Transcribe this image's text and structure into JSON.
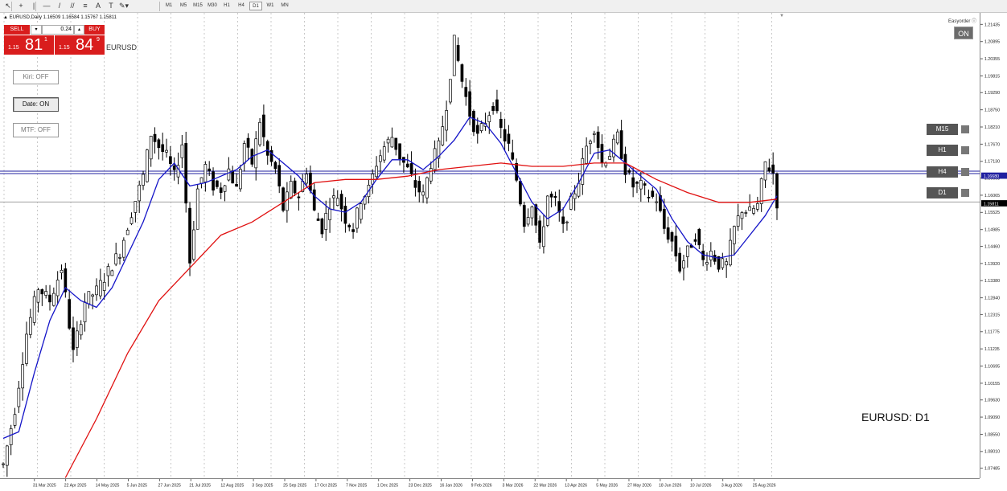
{
  "toolbar": {
    "icons": [
      {
        "name": "cursor-icon",
        "glyph": "↖"
      },
      {
        "name": "crosshair-icon",
        "glyph": "+"
      },
      {
        "name": "vertical-line-icon",
        "glyph": "|"
      },
      {
        "name": "horizontal-line-icon",
        "glyph": "—"
      },
      {
        "name": "trendline-icon",
        "glyph": "/"
      },
      {
        "name": "equidistant-channel-icon",
        "glyph": "//"
      },
      {
        "name": "fibonacci-icon",
        "glyph": "≡"
      },
      {
        "name": "text-icon",
        "glyph": "A"
      },
      {
        "name": "text-label-icon",
        "glyph": "T"
      },
      {
        "name": "shapes-menu-icon",
        "glyph": "✎▾"
      }
    ],
    "timeframes": [
      "M1",
      "M5",
      "M15",
      "M30",
      "H1",
      "H4",
      "D1",
      "W1",
      "MN"
    ],
    "active_timeframe": "D1"
  },
  "header": {
    "text": "▲ EURUSD,Daily  1.16509 1.16584 1.15767 1.15811"
  },
  "trade_panel": {
    "sell_label": "SELL",
    "buy_label": "BUY",
    "volume": "0.24",
    "down_arrow": "▾",
    "up_arrow": "▴",
    "bid_prefix": "1.15",
    "bid_big": "81",
    "bid_sup": "1",
    "ask_prefix": "1.15",
    "ask_big": "84",
    "ask_sup": "9",
    "symbol": "EURUSD",
    "color": "#d91d1d"
  },
  "toggles": [
    {
      "name": "kiri-toggle-button",
      "label": "Kiri: OFF",
      "on": false
    },
    {
      "name": "date-toggle-button",
      "label": "Date: ON",
      "on": true
    },
    {
      "name": "mtf-toggle-button",
      "label": "MTF: OFF",
      "on": false
    }
  ],
  "easyorder": {
    "label": "Easyorder ⓘ",
    "state": "ON"
  },
  "mtf_buttons": [
    "M15",
    "H1",
    "H4",
    "D1"
  ],
  "watermark": "EURUSD: D1",
  "chart_data": {
    "type": "candlestick",
    "symbol": "EURUSD",
    "timeframe": "D1",
    "x_ticks": [
      "31 Mar 2025",
      "22 Apr 2025",
      "14 May 2025",
      "5 Jun 2025",
      "27 Jun 2025",
      "21 Jul 2025",
      "12 Aug 2025",
      "3 Sep 2025",
      "25 Sep 2025",
      "17 Oct 2025",
      "7 Nov 2025",
      "1 Dec 2025",
      "23 Dec 2025",
      "16 Jan 2026",
      "9 Feb 2026",
      "3 Mar 2026",
      "22 Mar 2026",
      "13 Apr 2026",
      "5 May 2026",
      "27 May 2026",
      "18 Jun 2026",
      "10 Jul 2026",
      "3 Aug 2026",
      "25 Aug 2026"
    ],
    "y_ticks": [
      "1.21435",
      "1.20895",
      "1.20355",
      "1.19815",
      "1.19290",
      "1.18750",
      "1.18210",
      "1.17670",
      "1.17130",
      "1.16605",
      "1.16065",
      "1.15525",
      "1.14985",
      "1.14460",
      "1.13920",
      "1.13380",
      "1.12840",
      "1.12315",
      "1.11775",
      "1.11235",
      "1.10695",
      "1.10155",
      "1.09630",
      "1.09090",
      "1.08550",
      "1.08010",
      "1.07485"
    ],
    "ylim": [
      1.07485,
      1.21435
    ],
    "current_bid": "1.15811",
    "horizontal_line": "1.16680",
    "price_path": [
      [
        0,
        1.078
      ],
      [
        3,
        1.095
      ],
      [
        6,
        1.118
      ],
      [
        9,
        1.132
      ],
      [
        12,
        1.128
      ],
      [
        15,
        1.138
      ],
      [
        18,
        1.112
      ],
      [
        21,
        1.128
      ],
      [
        24,
        1.131
      ],
      [
        27,
        1.137
      ],
      [
        30,
        1.143
      ],
      [
        33,
        1.155
      ],
      [
        36,
        1.166
      ],
      [
        38,
        1.179
      ],
      [
        40,
        1.175
      ],
      [
        42,
        1.172
      ],
      [
        44,
        1.166
      ],
      [
        46,
        1.176
      ],
      [
        48,
        1.14
      ],
      [
        50,
        1.162
      ],
      [
        52,
        1.169
      ],
      [
        54,
        1.163
      ],
      [
        56,
        1.162
      ],
      [
        58,
        1.168
      ],
      [
        60,
        1.162
      ],
      [
        62,
        1.176
      ],
      [
        64,
        1.17
      ],
      [
        66,
        1.183
      ],
      [
        68,
        1.172
      ],
      [
        70,
        1.168
      ],
      [
        72,
        1.156
      ],
      [
        74,
        1.163
      ],
      [
        76,
        1.16
      ],
      [
        78,
        1.168
      ],
      [
        80,
        1.155
      ],
      [
        82,
        1.15
      ],
      [
        84,
        1.158
      ],
      [
        86,
        1.16
      ],
      [
        88,
        1.153
      ],
      [
        90,
        1.15
      ],
      [
        92,
        1.159
      ],
      [
        94,
        1.162
      ],
      [
        96,
        1.17
      ],
      [
        98,
        1.175
      ],
      [
        100,
        1.178
      ],
      [
        102,
        1.172
      ],
      [
        104,
        1.168
      ],
      [
        106,
        1.163
      ],
      [
        108,
        1.16
      ],
      [
        110,
        1.17
      ],
      [
        112,
        1.175
      ],
      [
        114,
        1.188
      ],
      [
        116,
        1.207
      ],
      [
        118,
        1.195
      ],
      [
        120,
        1.185
      ],
      [
        122,
        1.178
      ],
      [
        124,
        1.183
      ],
      [
        126,
        1.188
      ],
      [
        128,
        1.18
      ],
      [
        130,
        1.175
      ],
      [
        132,
        1.165
      ],
      [
        134,
        1.152
      ],
      [
        136,
        1.158
      ],
      [
        138,
        1.144
      ],
      [
        140,
        1.16
      ],
      [
        142,
        1.158
      ],
      [
        144,
        1.15
      ],
      [
        146,
        1.158
      ],
      [
        148,
        1.165
      ],
      [
        150,
        1.175
      ],
      [
        152,
        1.181
      ],
      [
        154,
        1.17
      ],
      [
        156,
        1.173
      ],
      [
        158,
        1.178
      ],
      [
        160,
        1.168
      ],
      [
        162,
        1.163
      ],
      [
        164,
        1.163
      ],
      [
        166,
        1.16
      ],
      [
        168,
        1.159
      ],
      [
        170,
        1.15
      ],
      [
        172,
        1.146
      ],
      [
        174,
        1.138
      ],
      [
        176,
        1.143
      ],
      [
        178,
        1.148
      ],
      [
        180,
        1.14
      ],
      [
        182,
        1.143
      ],
      [
        184,
        1.139
      ],
      [
        186,
        1.139
      ],
      [
        188,
        1.15
      ],
      [
        190,
        1.156
      ],
      [
        192,
        1.155
      ],
      [
        194,
        1.157
      ],
      [
        196,
        1.17
      ],
      [
        198,
        1.167
      ],
      [
        199,
        1.158
      ]
    ],
    "series": [
      {
        "name": "MA fast",
        "color": "#1414c8",
        "values": [
          [
            0,
            1.086
          ],
          [
            4,
            1.088
          ],
          [
            8,
            1.106
          ],
          [
            12,
            1.122
          ],
          [
            16,
            1.132
          ],
          [
            20,
            1.128
          ],
          [
            24,
            1.126
          ],
          [
            28,
            1.132
          ],
          [
            32,
            1.142
          ],
          [
            36,
            1.152
          ],
          [
            40,
            1.165
          ],
          [
            44,
            1.17
          ],
          [
            48,
            1.163
          ],
          [
            52,
            1.164
          ],
          [
            56,
            1.166
          ],
          [
            60,
            1.168
          ],
          [
            64,
            1.172
          ],
          [
            68,
            1.174
          ],
          [
            72,
            1.17
          ],
          [
            76,
            1.166
          ],
          [
            80,
            1.16
          ],
          [
            84,
            1.156
          ],
          [
            88,
            1.155
          ],
          [
            92,
            1.158
          ],
          [
            96,
            1.165
          ],
          [
            100,
            1.171
          ],
          [
            104,
            1.171
          ],
          [
            108,
            1.168
          ],
          [
            112,
            1.172
          ],
          [
            116,
            1.177
          ],
          [
            120,
            1.184
          ],
          [
            124,
            1.182
          ],
          [
            128,
            1.176
          ],
          [
            132,
            1.167
          ],
          [
            136,
            1.158
          ],
          [
            140,
            1.153
          ],
          [
            144,
            1.156
          ],
          [
            148,
            1.164
          ],
          [
            152,
            1.173
          ],
          [
            156,
            1.174
          ],
          [
            160,
            1.17
          ],
          [
            164,
            1.166
          ],
          [
            168,
            1.162
          ],
          [
            172,
            1.153
          ],
          [
            176,
            1.146
          ],
          [
            180,
            1.142
          ],
          [
            184,
            1.141
          ],
          [
            188,
            1.142
          ],
          [
            192,
            1.148
          ],
          [
            196,
            1.154
          ],
          [
            199,
            1.16
          ]
        ]
      },
      {
        "name": "MA slow",
        "color": "#e01010",
        "values": [
          [
            16,
            1.074
          ],
          [
            24,
            1.092
          ],
          [
            32,
            1.112
          ],
          [
            40,
            1.128
          ],
          [
            48,
            1.138
          ],
          [
            56,
            1.148
          ],
          [
            64,
            1.152
          ],
          [
            72,
            1.158
          ],
          [
            80,
            1.164
          ],
          [
            88,
            1.165
          ],
          [
            96,
            1.165
          ],
          [
            104,
            1.166
          ],
          [
            112,
            1.168
          ],
          [
            120,
            1.169
          ],
          [
            128,
            1.17
          ],
          [
            136,
            1.169
          ],
          [
            144,
            1.169
          ],
          [
            152,
            1.17
          ],
          [
            160,
            1.17
          ],
          [
            168,
            1.165
          ],
          [
            176,
            1.161
          ],
          [
            184,
            1.158
          ],
          [
            192,
            1.158
          ],
          [
            199,
            1.159
          ]
        ]
      }
    ]
  }
}
